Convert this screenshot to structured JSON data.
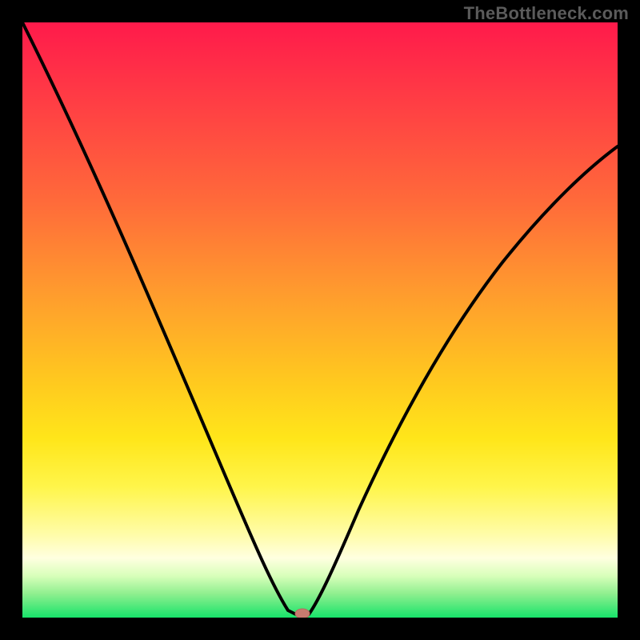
{
  "watermark": "TheBottleneck.com",
  "chart_data": {
    "type": "line",
    "title": "",
    "xlabel": "",
    "ylabel": "",
    "xlim": [
      0,
      100
    ],
    "ylim": [
      0,
      100
    ],
    "x": [
      0,
      5,
      10,
      15,
      20,
      25,
      30,
      35,
      40,
      42,
      44,
      46,
      48,
      50,
      55,
      60,
      65,
      70,
      75,
      80,
      85,
      90,
      95,
      100
    ],
    "values": [
      100,
      90,
      80,
      70,
      60,
      49,
      38,
      26,
      12,
      6,
      2,
      0,
      0,
      3,
      12,
      24,
      36,
      46,
      54,
      61,
      67,
      72,
      76,
      80
    ],
    "marker": {
      "x": 47,
      "y": 0.6,
      "color": "#c77b6f"
    },
    "background_gradient": [
      "#ff1a4b",
      "#ff9a2e",
      "#ffe61a",
      "#fffca8",
      "#17e36a"
    ]
  }
}
